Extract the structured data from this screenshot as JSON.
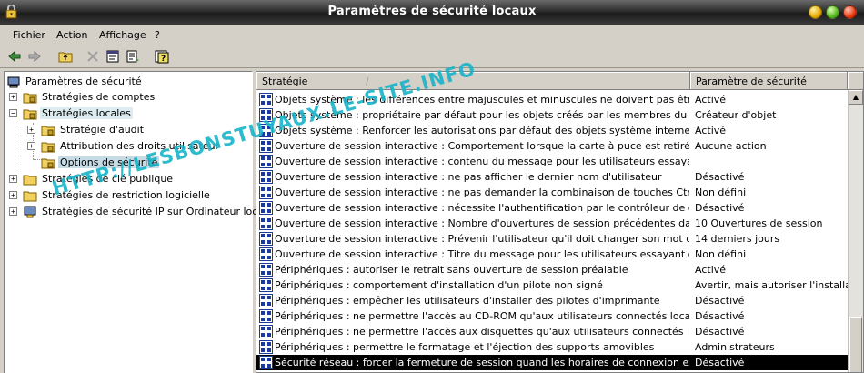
{
  "window": {
    "title": "Paramètres de sécurité locaux"
  },
  "menu": {
    "items": [
      "Fichier",
      "Action",
      "Affichage",
      "?"
    ]
  },
  "toolbar": {
    "buttons": [
      "back-arrow-icon",
      "forward-arrow-icon",
      "up-folder-icon",
      "delete-icon",
      "properties-icon",
      "export-list-icon",
      "help-icon"
    ]
  },
  "tree": {
    "root": "Paramètres de sécurité",
    "nodes": [
      {
        "label": "Stratégies de comptes",
        "expander": "+"
      },
      {
        "label": "Stratégies locales",
        "expander": "−"
      },
      {
        "label": "Stratégie d'audit",
        "expander": "+"
      },
      {
        "label": "Attribution des droits utilisateur",
        "expander": "+"
      },
      {
        "label": "Options de sécurité"
      },
      {
        "label": "Stratégies de clé publique",
        "expander": "+"
      },
      {
        "label": "Stratégies de restriction logicielle",
        "expander": "+"
      },
      {
        "label": "Stratégies de sécurité IP sur Ordinateur local",
        "expander": "+"
      }
    ]
  },
  "list": {
    "columns": [
      "Stratégie",
      "Paramètre de sécurité"
    ],
    "sort_indicator": "/",
    "rows": [
      {
        "policy": "Objets système : les différences entre majuscules et minuscules ne doivent pas être prises ...",
        "setting": "Activé"
      },
      {
        "policy": "Objets système : propriétaire par défaut pour les objets créés par les membres du groupe A...",
        "setting": "Créateur d'objet"
      },
      {
        "policy": "Objets système : Renforcer les autorisations par défaut des objets système internes (comm...",
        "setting": "Activé"
      },
      {
        "policy": "Ouverture de session interactive : Comportement lorsque la carte à puce est retirée",
        "setting": "Aucune action"
      },
      {
        "policy": "Ouverture de session interactive : contenu du message pour les utilisateurs essayant de se ...",
        "setting": ""
      },
      {
        "policy": "Ouverture de session interactive : ne pas afficher le dernier nom d'utilisateur",
        "setting": "Désactivé"
      },
      {
        "policy": "Ouverture de session interactive : ne pas demander la combinaison de touches Ctrl+Alt+Su...",
        "setting": "Non défini"
      },
      {
        "policy": "Ouverture de session interactive : nécessite l'authentification par le contrôleur de domaine ...",
        "setting": "Désactivé"
      },
      {
        "policy": "Ouverture de session interactive : Nombre d'ouvertures de session précédentes dans le cac...",
        "setting": "10 Ouvertures de session"
      },
      {
        "policy": "Ouverture de session interactive : Prévenir l'utilisateur qu'il doit changer son mot de passe ...",
        "setting": "14 derniers jours"
      },
      {
        "policy": "Ouverture de session interactive : Titre du message pour les utilisateurs essayant de se con...",
        "setting": "Non défini"
      },
      {
        "policy": "Périphériques : autoriser le retrait sans ouverture de session préalable",
        "setting": "Activé"
      },
      {
        "policy": "Périphériques : comportement d'installation d'un pilote non signé",
        "setting": "Avertir, mais autoriser l'installation"
      },
      {
        "policy": "Périphériques : empêcher les utilisateurs d'installer des pilotes d'imprimante",
        "setting": "Désactivé"
      },
      {
        "policy": "Périphériques : ne permettre l'accès au CD-ROM qu'aux utilisateurs connectés localement",
        "setting": "Désactivé"
      },
      {
        "policy": "Périphériques : ne permettre l'accès aux disquettes qu'aux utilisateurs connectés localement",
        "setting": "Désactivé"
      },
      {
        "policy": "Périphériques : permettre le formatage et l'éjection des supports amovibles",
        "setting": "Administrateurs"
      },
      {
        "policy": "Sécurité réseau : forcer la fermeture de session quand les horaires de connexion expirent",
        "setting": "Désactivé",
        "selected": true
      }
    ]
  },
  "watermark": "HTTP://LESBONSTUYAUX.LE-SITE.INFO"
}
